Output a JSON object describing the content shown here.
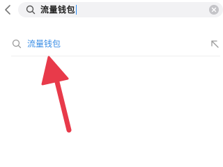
{
  "search": {
    "value": "流量钱包",
    "icon": "search-icon"
  },
  "suggestions": [
    {
      "label": "流量钱包",
      "icon": "search-icon",
      "action_icon": "arrow-up-left-icon"
    }
  ],
  "colors": {
    "accent": "#3a8ee6",
    "search_bg": "#f2f2f4",
    "annotation_arrow": "#e83a4a"
  },
  "icons": {
    "back": "chevron-left-icon",
    "clear": "clear-icon"
  }
}
